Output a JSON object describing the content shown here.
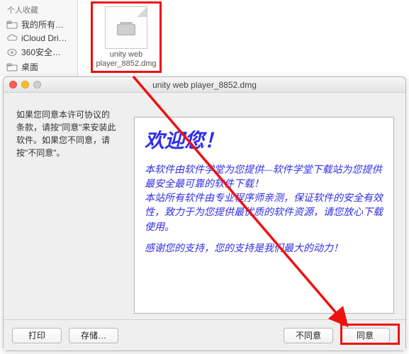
{
  "finder": {
    "sidebar_header": "个人收藏",
    "items": [
      {
        "label": "我的所有…",
        "icon": "folder-icon"
      },
      {
        "label": "iCloud Dri…",
        "icon": "cloud-icon"
      },
      {
        "label": "360安全…",
        "icon": "disk-icon"
      },
      {
        "label": "桌面",
        "icon": "folder-icon"
      }
    ],
    "file": {
      "name_line1": "unity web",
      "name_line2": "player_8852.dmg"
    }
  },
  "dialog": {
    "title": "unity web player_8852.dmg",
    "left_text": "如果您同意本许可协议的条款，请按\"同意\"来安装此软件。如果您不同意，请按\"不同意\"。",
    "doc": {
      "title": "欢迎您！",
      "body": "本软件由软件学堂为您提供—软件学堂下载站为您提供最安全最可靠的软件下载！\n本站所有软件由专业程序师亲测，保证软件的安全有效性，致力于为您提供最优质的软件资源，请您放心下载使用。",
      "thanks": "感谢您的支持，您的支持是我们最大的动力！"
    },
    "buttons": {
      "print": "打印",
      "save": "存储…",
      "disagree": "不同意",
      "agree": "同意"
    }
  }
}
